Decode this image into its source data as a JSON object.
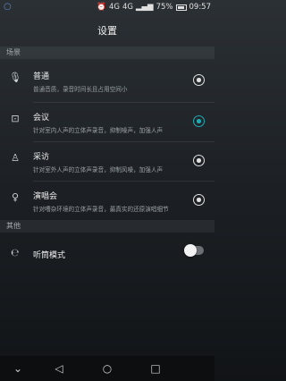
{
  "status_bar": {
    "network": "4G",
    "network2": "4G",
    "battery_percent": "75%",
    "time": "09:57"
  },
  "header": {
    "title": "设置"
  },
  "sections": {
    "scene": "场景",
    "other": "其他"
  },
  "modes": [
    {
      "title": "普通",
      "subtitle": "普通音质，录音时间长且占用空间小",
      "icon": "microphone-icon",
      "selected": false
    },
    {
      "title": "会议",
      "subtitle": "针对室内人声的立体声录音，抑制噪声，加强人声",
      "icon": "presentation-board-icon",
      "selected": true
    },
    {
      "title": "采访",
      "subtitle": "针对室外人声的立体声录音，抑制风噪，加强人声",
      "icon": "interview-mic-icon",
      "selected": false
    },
    {
      "title": "演唱会",
      "subtitle": "针对嘈杂环境的立体声录音，最真实的还原演唱细节",
      "icon": "concert-mic-icon",
      "selected": false
    }
  ],
  "other_items": {
    "earpiece_mode": {
      "title": "听筒模式",
      "icon": "ear-icon",
      "enabled": false
    }
  },
  "accent_color": "#1fa9b2"
}
